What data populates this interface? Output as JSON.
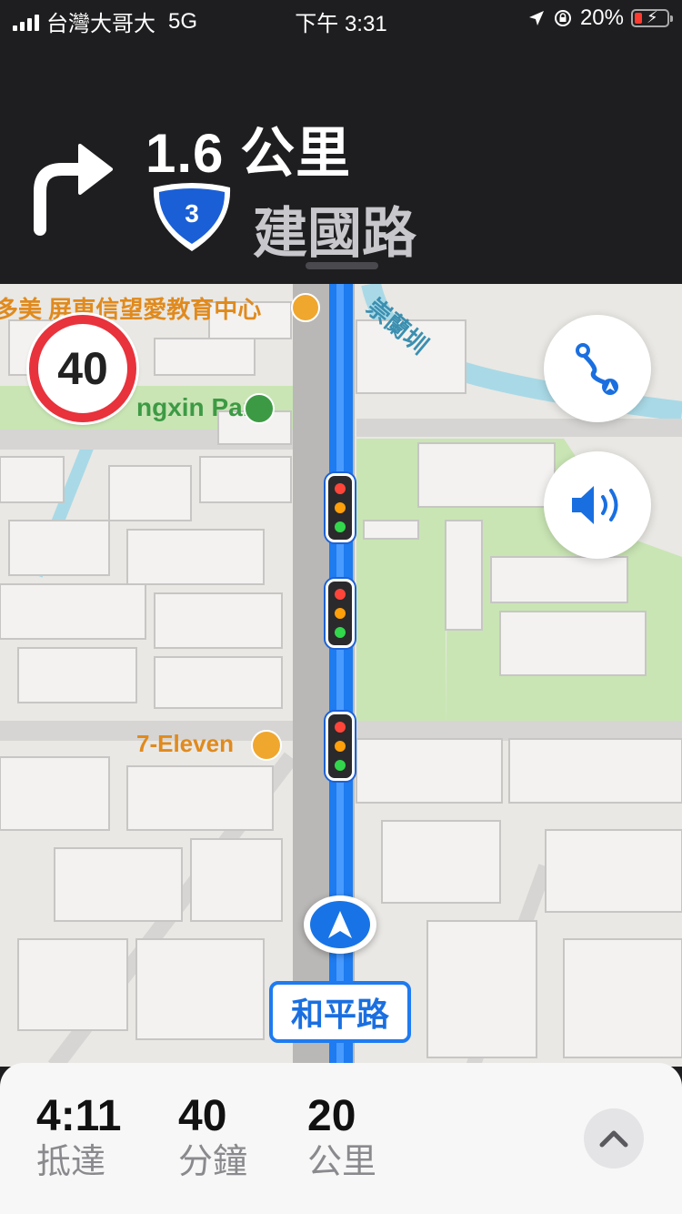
{
  "status_bar": {
    "carrier": "台灣大哥大",
    "network": "5G",
    "time": "下午 3:31",
    "battery": "20%"
  },
  "maneuver": {
    "distance": "1.6 公里",
    "route_number": "3",
    "street": "建國路",
    "direction_icon": "turn-right-arrow-icon"
  },
  "map": {
    "speed_limit": "40",
    "labels": {
      "education_center": "多美 屏東信望愛教育中心",
      "park": "ngxin Park",
      "store": "7-Eleven",
      "canal": "崇蘭圳",
      "current_road": "和平路"
    },
    "route_color": "#1e7bf0",
    "buttons": {
      "route_overview_icon": "route-overview-icon",
      "audio_icon": "speaker-icon"
    }
  },
  "trip": {
    "arrival_time": "4:11",
    "arrival_label": "抵達",
    "minutes": "40",
    "minutes_label": "分鐘",
    "distance": "20",
    "distance_label": "公里",
    "expand_icon": "chevron-up-icon"
  }
}
